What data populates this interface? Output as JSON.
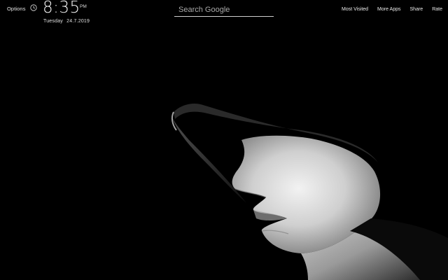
{
  "header": {
    "options_label": "Options",
    "time": "8:35",
    "ampm": "PM",
    "weekday": "Tuesday",
    "date": "24.7.2019"
  },
  "search": {
    "placeholder": "Search Google"
  },
  "nav": {
    "most_visited": "Most Visited",
    "more_apps": "More Apps",
    "share": "Share",
    "rate": "Rate"
  },
  "icons": {
    "clock": "clock-icon"
  },
  "colors": {
    "background": "#000000",
    "text": "#ffffff"
  }
}
